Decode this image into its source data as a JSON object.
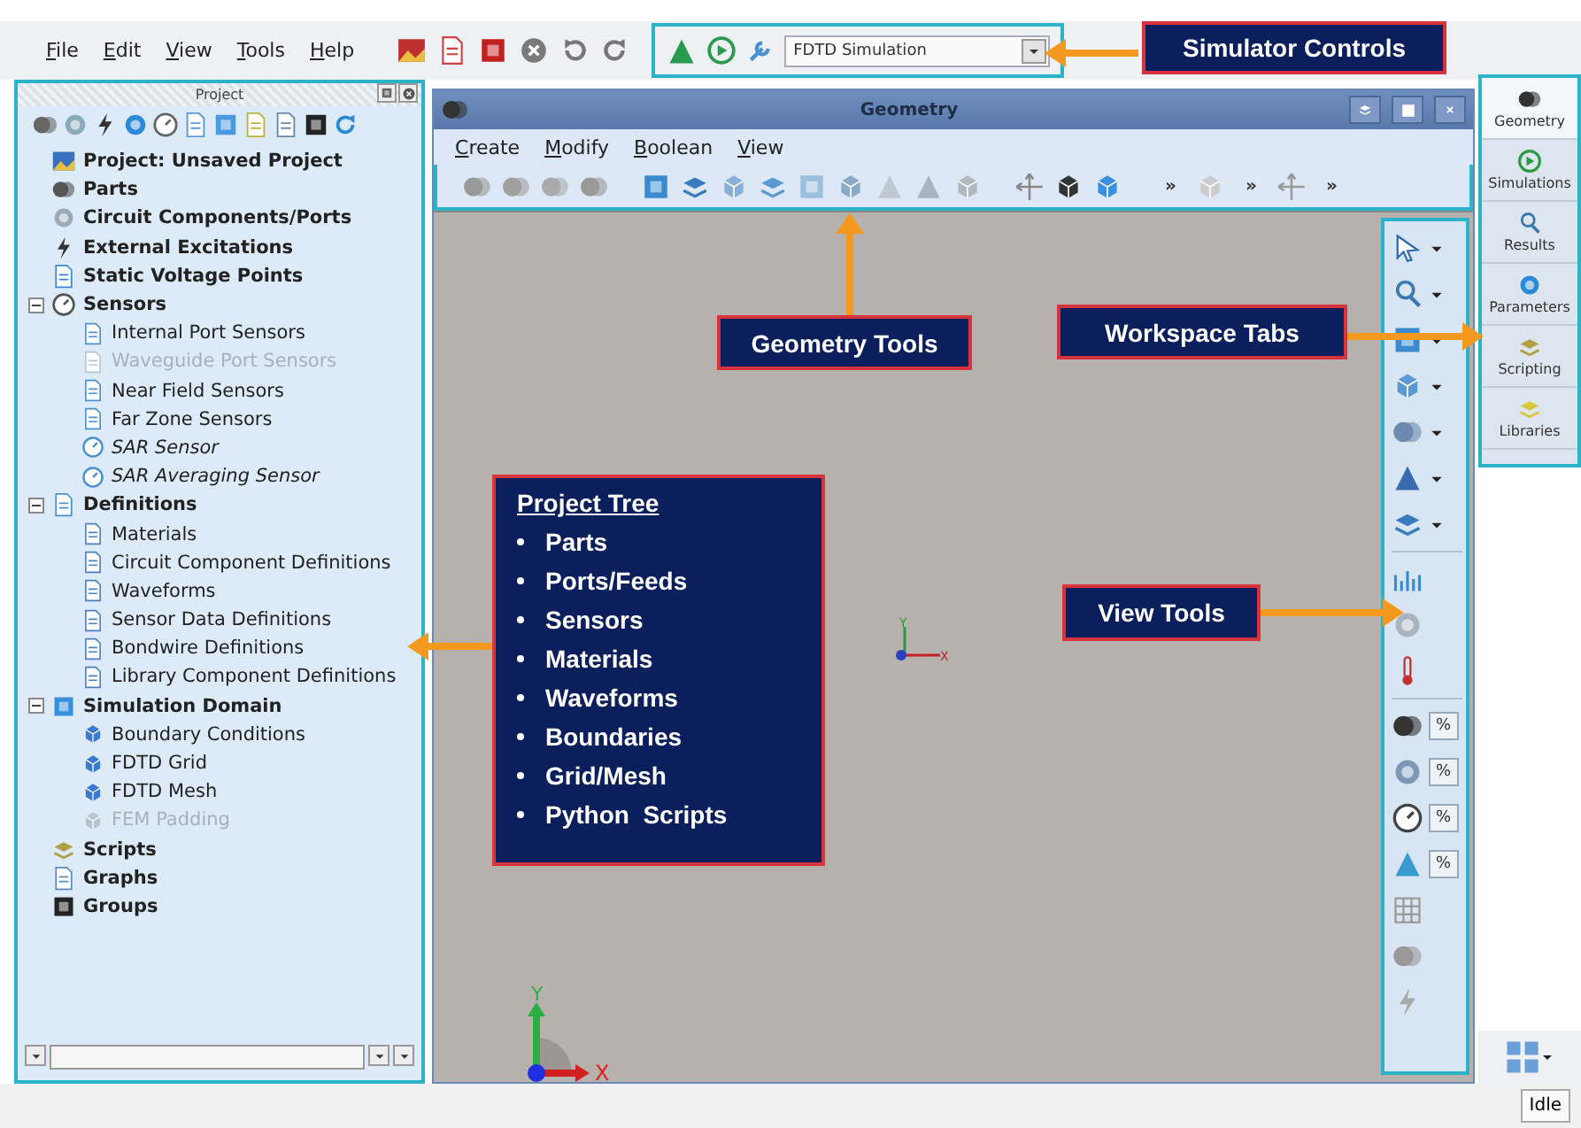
{
  "menu": [
    {
      "label": "File"
    },
    {
      "label": "Edit"
    },
    {
      "label": "View"
    },
    {
      "label": "Tools"
    },
    {
      "label": "Help"
    }
  ],
  "simulation_select": {
    "value": "FDTD Simulation"
  },
  "project_panel": {
    "title": "Project",
    "tree": [
      {
        "label": "Project: Unsaved Project"
      },
      {
        "label": "Parts"
      },
      {
        "label": "Circuit Components/Ports"
      },
      {
        "label": "External Excitations"
      },
      {
        "label": "Static Voltage Points"
      },
      {
        "label": "Sensors",
        "expanded": true,
        "children": [
          {
            "label": "Internal Port Sensors",
            "disabled": false,
            "italic": false
          },
          {
            "label": "Waveguide Port Sensors",
            "disabled": true,
            "italic": false
          },
          {
            "label": "Near Field Sensors",
            "disabled": false,
            "italic": false
          },
          {
            "label": "Far Zone Sensors",
            "disabled": false,
            "italic": false
          },
          {
            "label": "SAR Sensor",
            "disabled": false,
            "italic": true
          },
          {
            "label": "SAR Averaging Sensor",
            "disabled": false,
            "italic": true
          }
        ]
      },
      {
        "label": "Definitions",
        "expanded": true,
        "children": [
          {
            "label": "Materials",
            "disabled": false,
            "italic": false
          },
          {
            "label": "Circuit Component Definitions",
            "disabled": false,
            "italic": false
          },
          {
            "label": "Waveforms",
            "disabled": false,
            "italic": false
          },
          {
            "label": "Sensor Data Definitions",
            "disabled": false,
            "italic": false
          },
          {
            "label": "Bondwire Definitions",
            "disabled": false,
            "italic": false
          },
          {
            "label": "Library Component Definitions",
            "disabled": false,
            "italic": false
          }
        ]
      },
      {
        "label": "Simulation Domain",
        "expanded": true,
        "children": [
          {
            "label": "Boundary Conditions",
            "disabled": false,
            "italic": false
          },
          {
            "label": "FDTD Grid",
            "disabled": false,
            "italic": false
          },
          {
            "label": "FDTD Mesh",
            "disabled": false,
            "italic": false
          },
          {
            "label": "FEM Padding",
            "disabled": true,
            "italic": false
          }
        ]
      },
      {
        "label": "Scripts"
      },
      {
        "label": "Graphs"
      },
      {
        "label": "Groups"
      }
    ]
  },
  "geometry_window": {
    "title": "Geometry",
    "menu": [
      {
        "label": "Create"
      },
      {
        "label": "Modify"
      },
      {
        "label": "Boolean"
      },
      {
        "label": "View"
      }
    ],
    "toolbar_overflow": [
      "»",
      "»",
      "»"
    ],
    "viewport": {
      "triad": {
        "x": "X",
        "y": "Y"
      },
      "origin_marker": {
        "x": "X",
        "y": "Y"
      }
    },
    "view_tools_percent": [
      "%",
      "%",
      "%",
      "%"
    ]
  },
  "workspace_tabs": [
    {
      "label": "Geometry",
      "selected": true
    },
    {
      "label": "Simulations",
      "selected": false
    },
    {
      "label": "Results",
      "selected": false
    },
    {
      "label": "Parameters",
      "selected": false
    },
    {
      "label": "Scripting",
      "selected": false
    },
    {
      "label": "Libraries",
      "selected": false
    }
  ],
  "status_bar": {
    "status": "Idle"
  },
  "annotations": {
    "simulator_controls": "Simulator Controls",
    "geometry_tools": "Geometry Tools",
    "workspace_tabs": "Workspace Tabs",
    "view_tools": "View Tools",
    "project_tree": {
      "title": "Project Tree",
      "items": [
        "Parts",
        "Ports/Feeds",
        "Sensors",
        "Materials",
        "Waveforms",
        "Boundaries",
        "Grid/Mesh",
        "Python  Scripts"
      ]
    }
  }
}
